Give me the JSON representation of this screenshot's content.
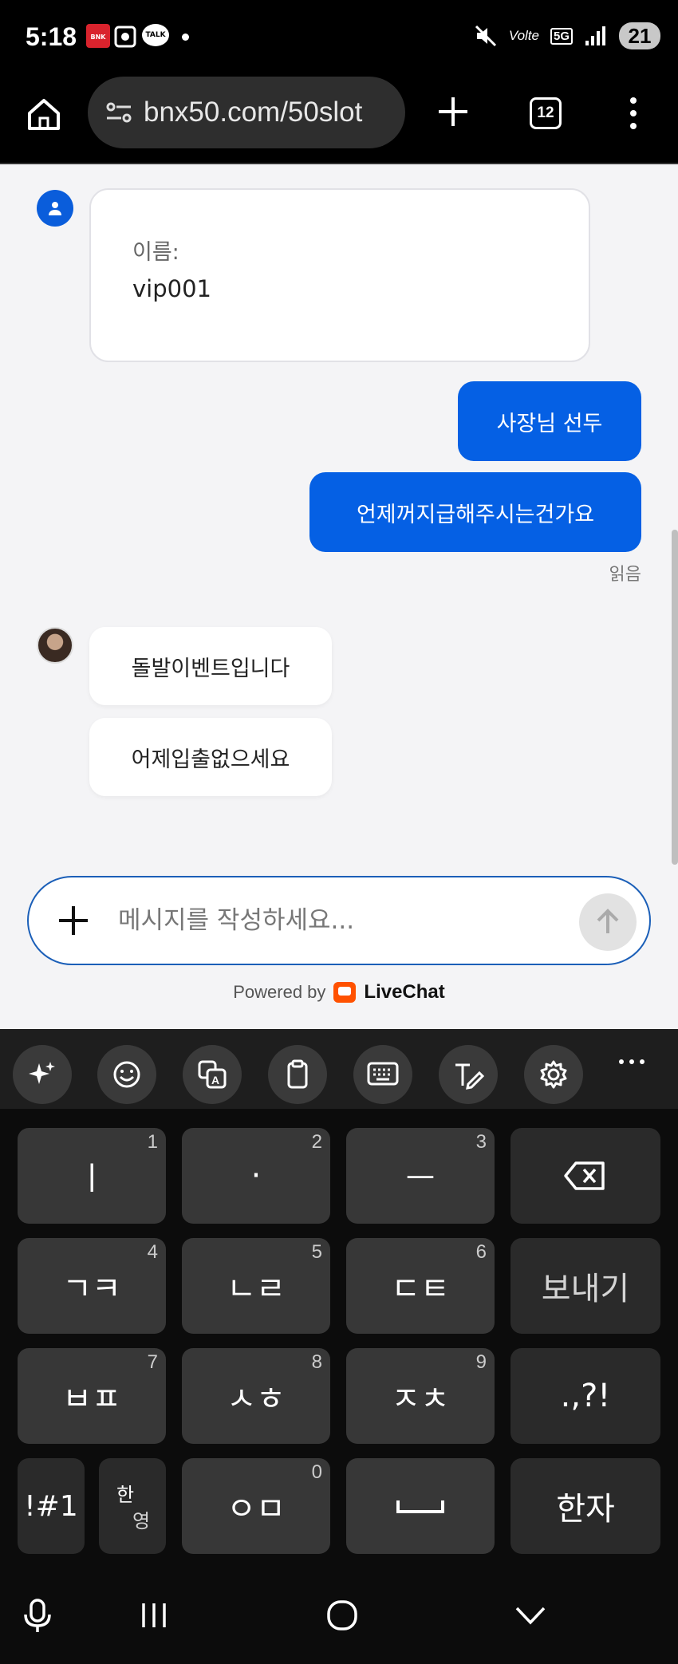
{
  "status_bar": {
    "time": "5:18",
    "bnk_label": "BNK",
    "talk_label": "TALK",
    "volte": "Volte",
    "network": "5G",
    "battery": "21"
  },
  "browser": {
    "url": "bnx50.com/50slot",
    "tab_count": "12"
  },
  "chat": {
    "form": {
      "label": "이름:",
      "value": "vip001"
    },
    "outgoing": [
      {
        "text": "사장님 선두"
      },
      {
        "text": "언제꺼지급해주시는건가요"
      }
    ],
    "read_status": "읽음",
    "incoming": [
      {
        "text": "돌발이벤트입니다"
      },
      {
        "text": "어제입출없으세요"
      }
    ],
    "composer_placeholder": "메시지를 작성하세요...",
    "powered_by": "Powered by",
    "brand": "LiveChat"
  },
  "keyboard": {
    "toolbar_icons": [
      "sparkle-ai-icon",
      "emoji-icon",
      "translate-icon",
      "clipboard-icon",
      "keyboard-layout-icon",
      "handwriting-icon",
      "settings-icon",
      "more-icon"
    ],
    "rows": [
      [
        {
          "label": "ㅣ",
          "num": "1"
        },
        {
          "label": "·",
          "num": "2"
        },
        {
          "label": "ㅡ",
          "num": "3"
        },
        {
          "label": "⌫",
          "num": ""
        }
      ],
      [
        {
          "label": "ㄱㅋ",
          "num": "4"
        },
        {
          "label": "ㄴㄹ",
          "num": "5"
        },
        {
          "label": "ㄷㅌ",
          "num": "6"
        },
        {
          "label": "보내기",
          "num": ""
        }
      ],
      [
        {
          "label": "ㅂㅍ",
          "num": "7"
        },
        {
          "label": "ㅅㅎ",
          "num": "8"
        },
        {
          "label": "ㅈㅊ",
          "num": "9"
        },
        {
          "label": ".,?!",
          "num": ""
        }
      ],
      [
        {
          "label": "!#1",
          "num": ""
        },
        {
          "label_top": "한",
          "label_bottom": "영"
        },
        {
          "label": "ㅇㅁ",
          "num": "0"
        },
        {
          "label": "␣",
          "num": ""
        },
        {
          "label": "한자",
          "num": ""
        }
      ]
    ]
  }
}
